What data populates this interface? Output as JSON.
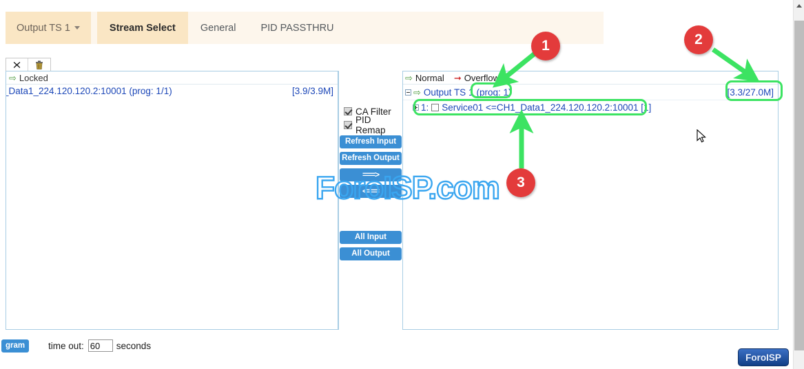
{
  "tabs": [
    {
      "label": "Output TS 1",
      "type": "dropdown",
      "name": "tab-output-ts-1"
    },
    {
      "label": "Stream Select",
      "type": "active",
      "name": "tab-stream-select"
    },
    {
      "label": "General",
      "type": "normal",
      "name": "tab-general"
    },
    {
      "label": "PID PASSTHRU",
      "type": "normal",
      "name": "tab-pid-passthru"
    }
  ],
  "toolbar": {
    "close_icon": "x-icon",
    "delete_icon": "trash-icon"
  },
  "left_panel": {
    "header": "Locked",
    "items": [
      {
        "label": "_Data1_224.120.120.2:10001 (prog: 1/1)",
        "bitrate": "[3.9/3.9M]"
      }
    ]
  },
  "center_panel": {
    "checkboxes": [
      {
        "label": "CA Filter",
        "checked": true
      },
      {
        "label": "PID Remap",
        "checked": true
      }
    ],
    "buttons": [
      {
        "label": "Refresh Input",
        "name": "refresh-input-button"
      },
      {
        "label": "Refresh Output",
        "name": "refresh-output-button"
      },
      {
        "label": "===>",
        "name": "move-right-button"
      },
      {
        "label": "<===",
        "name": "move-left-button"
      },
      {
        "label": "All Input",
        "name": "all-input-button"
      },
      {
        "label": "All Output",
        "name": "all-output-button"
      }
    ]
  },
  "right_panel": {
    "legend": [
      {
        "label": "Normal",
        "arrow": "green"
      },
      {
        "label": "Overflow",
        "arrow": "red"
      }
    ],
    "root": {
      "label": "Output TS 1",
      "prog": "(prog: 1)",
      "bitrate": "[3.3/27.0M]"
    },
    "children": [
      {
        "label": "1:",
        "service": "Service01 <=CH1_Data1_224.120.120.2:10001 [1]"
      }
    ]
  },
  "bottom_bar": {
    "program_button": "gram",
    "timeout_label": "time out:",
    "timeout_value": "60",
    "timeout_placeholder": "60",
    "seconds_label": "seconds"
  },
  "watermark": {
    "text": "ForoISP.com"
  },
  "badge": {
    "text": "ForoISP"
  },
  "annotations": {
    "markers": [
      {
        "number": "1"
      },
      {
        "number": "2"
      },
      {
        "number": "3"
      }
    ],
    "highlight_color": "#3ce362",
    "marker_color": "#e33b3b"
  }
}
